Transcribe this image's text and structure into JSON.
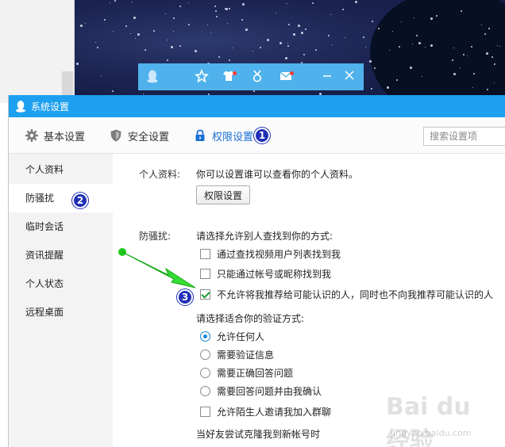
{
  "mini_bar": {
    "icons": [
      "qq-penguin-icon",
      "star-icon",
      "shirt-icon",
      "medal-icon",
      "mail-icon",
      "minimize-icon",
      "close-icon"
    ],
    "accent": "#4fb2ec"
  },
  "window": {
    "title": "系统设置",
    "titlebar_color": "#1ea0f0"
  },
  "tabs": [
    {
      "label": "基本设置",
      "icon": "gear-icon"
    },
    {
      "label": "安全设置",
      "icon": "shield-icon"
    },
    {
      "label": "权限设置",
      "icon": "lock-icon",
      "active": true
    }
  ],
  "search": {
    "placeholder": "搜索设置项"
  },
  "sidebar": {
    "items": [
      {
        "label": "个人资料"
      },
      {
        "label": "防骚扰",
        "active": true
      },
      {
        "label": "临时会话"
      },
      {
        "label": "资讯提醒"
      },
      {
        "label": "个人状态"
      },
      {
        "label": "远程桌面"
      }
    ]
  },
  "content": {
    "profile": {
      "label": "个人资料:",
      "description": "你可以设置谁可以查看你的个人资料。",
      "button": "权限设置"
    },
    "anti_harass": {
      "label": "防骚扰:",
      "find_heading": "请选择允许别人查找到你的方式:",
      "find_options": [
        {
          "label": "通过查找视频用户列表找到我",
          "checked": false
        },
        {
          "label": "只能通过帐号或昵称找到我",
          "checked": false
        },
        {
          "label": "不允许将我推荐给可能认识的人，同时也不向我推荐可能认识的人",
          "checked": true
        }
      ],
      "verify_heading": "请选择适合你的验证方式:",
      "verify_options": [
        {
          "label": "允许任何人",
          "checked": true
        },
        {
          "label": "需要验证信息",
          "checked": false
        },
        {
          "label": "需要正确回答问题",
          "checked": false
        },
        {
          "label": "需要回答问题并由我确认",
          "checked": false
        }
      ],
      "group_invite": {
        "label": "允许陌生人邀请我加入群聊",
        "checked": false
      },
      "clone_text": "当好友尝试克隆我到新帐号时"
    }
  },
  "annotations": [
    "1",
    "2",
    "3"
  ],
  "watermark": {
    "text": "Bai du 经验",
    "sub": "jingyan.baidu.com"
  }
}
